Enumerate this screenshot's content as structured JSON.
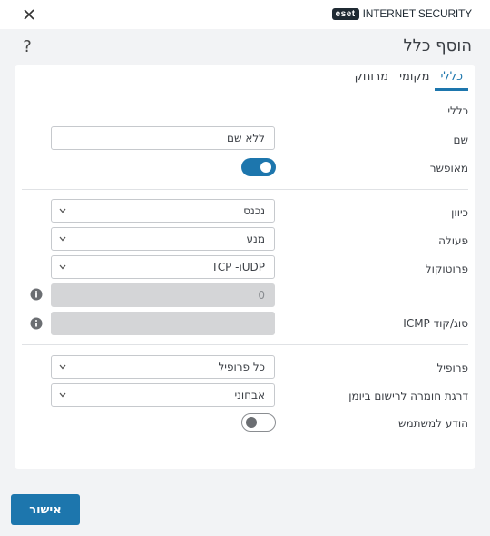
{
  "window": {
    "brand_logo": "eset",
    "brand_name": "INTERNET SECURITY",
    "close_icon": "close-icon",
    "help_label": "?"
  },
  "page_title": "הוסף כלל",
  "tabs": [
    {
      "label": "כללי",
      "active": true
    },
    {
      "label": "מקומי",
      "active": false
    },
    {
      "label": "מרוחק",
      "active": false
    }
  ],
  "section_general": {
    "heading": "כללי",
    "name_label": "שם",
    "name_value": "ללא שם",
    "enabled_label": "מאופשר",
    "enabled": true
  },
  "section_traffic": {
    "direction_label": "כיוון",
    "direction_value": "נכנס",
    "action_label": "פעולה",
    "action_value": "מנע",
    "protocol_label": "פרוטוקול",
    "protocol_value": "UDP‏ו- TCP",
    "port_value": "0",
    "icmp_label": "סוג/קוד ICMP",
    "icmp_value": ""
  },
  "section_profile": {
    "profile_label": "פרופיל",
    "profile_value": "כל פרופיל",
    "logging_label": "דרגת חומרה לרישום ביומן",
    "logging_value": "אבחוני",
    "notify_label": "הודע למשתמש",
    "notify": false
  },
  "footer": {
    "ok_label": "אישור"
  },
  "colors": {
    "accent": "#1d76ad",
    "background": "#f2f3f5",
    "card": "#ffffff",
    "disabled_field": "#d4d5d7"
  }
}
